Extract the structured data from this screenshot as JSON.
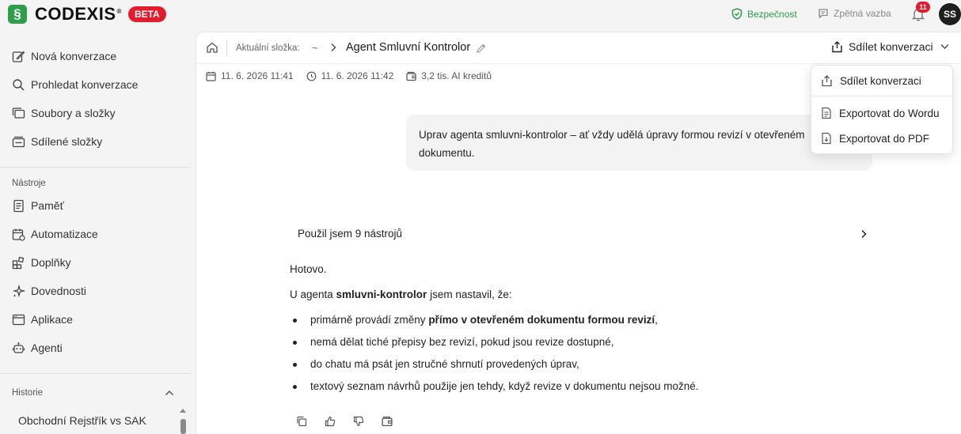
{
  "brand": {
    "name": "CODEXIS",
    "reg": "®",
    "badge": "BETA",
    "mark": "§"
  },
  "topbar": {
    "security": "Bezpečnost",
    "feedback": "Zpětná vazba",
    "notifications": "11",
    "avatar": "SS",
    "colors": {
      "accent": "#2e9e4a",
      "badge": "#e21b2d"
    }
  },
  "sidebar": {
    "primary": [
      {
        "label": "Nová konverzace",
        "icon": "edit-icon"
      },
      {
        "label": "Prohledat konverzace",
        "icon": "search-icon"
      },
      {
        "label": "Soubory a složky",
        "icon": "files-icon"
      },
      {
        "label": "Sdílené složky",
        "icon": "shared-folder-icon"
      }
    ],
    "tools_title": "Nástroje",
    "tools": [
      {
        "label": "Paměť",
        "icon": "memory-icon"
      },
      {
        "label": "Automatizace",
        "icon": "calendar-icon"
      },
      {
        "label": "Doplňky",
        "icon": "addons-icon"
      },
      {
        "label": "Dovednosti",
        "icon": "sparkle-icon"
      },
      {
        "label": "Aplikace",
        "icon": "app-window-icon"
      },
      {
        "label": "Agenti",
        "icon": "agent-icon"
      }
    ],
    "history_title": "Historie",
    "history": [
      "Obchodní Rejstřík vs SAK"
    ]
  },
  "header": {
    "folder_label": "Aktuální složka:",
    "folder": "~",
    "title": "Agent Smluvní Kontrolor",
    "share": "Sdílet konverzaci"
  },
  "meta": {
    "created": "11. 6. 2026 11:41",
    "updated": "11. 6. 2026 11:42",
    "credits": "3,2 tis. AI kreditů"
  },
  "chat": {
    "user_message": "Uprav agenta smluvni-kontrolor – ať vždy udělá úpravy formou revizí v otevřeném dokumentu.",
    "tools_used": "Použil jsem 9 nástrojů",
    "answer": {
      "done": "Hotovo.",
      "intro_pre": "U agenta ",
      "intro_bold": "smluvni-kontrolor",
      "intro_post": " jsem nastavil, že:",
      "bullet1_pre": "primárně provádí změny ",
      "bullet1_bold": "přímo v otevřeném dokumentu formou revizí",
      "bullet1_post": ",",
      "bullet2": "nemá dělat tiché přepisy bez revizí, pokud jsou revize dostupné,",
      "bullet3": "do chatu má psát jen stručné shrnutí provedených úprav,",
      "bullet4": "textový seznam návrhů použije jen tehdy, když revize v dokumentu nejsou možné."
    }
  },
  "dropdown": {
    "share": "Sdílet konverzaci",
    "export_word": "Exportovat do Wordu",
    "export_pdf": "Exportovat do PDF"
  }
}
